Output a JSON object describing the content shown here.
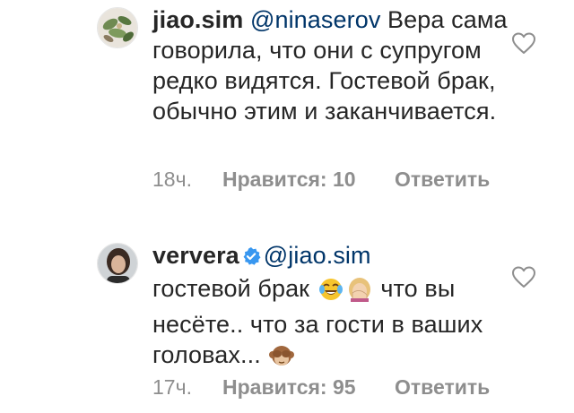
{
  "comments": [
    {
      "username": "jiao.sim",
      "verified": false,
      "mention": "@ninaserov",
      "text": "Вера сама говорила, что они с супругом редко видятся. Гостевой брак, обычно этим и заканчивается.",
      "time": "18ч.",
      "likes_label": "Нравится: 10",
      "reply_label": "Ответить"
    },
    {
      "username": "ververa",
      "verified": true,
      "mention": "@jiao.sim",
      "text_part1": "гостевой брак",
      "text_part2": "что вы несёте.. что за гости в ваших головах...",
      "emojis": [
        "face-with-tears-of-joy",
        "woman-facepalming",
        "see-no-evil-monkey"
      ],
      "time": "17ч.",
      "likes_label": "Нравится: 95",
      "reply_label": "Ответить"
    }
  ],
  "colors": {
    "text": "#262626",
    "mention": "#003569",
    "meta": "#8e8e8e",
    "verified": "#3897f0"
  }
}
